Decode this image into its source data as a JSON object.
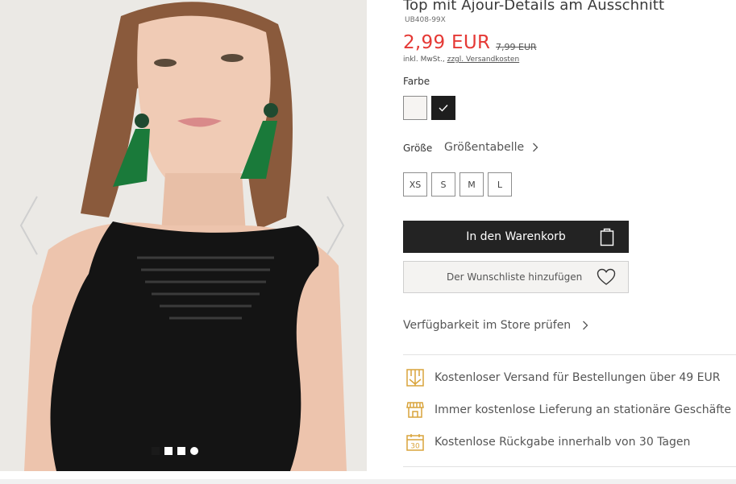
{
  "product": {
    "title": "Top mit Ajour-Details am Ausschnitt",
    "sku": "UB408-99X",
    "price": "2,99 EUR",
    "old_price": "7,99 EUR",
    "tax_prefix": "inkl. MwSt.,",
    "tax_link": "zzgl. Versandkosten"
  },
  "color": {
    "label": "Farbe",
    "swatches": [
      "white",
      "black"
    ],
    "selected": "black"
  },
  "size": {
    "label": "Größe",
    "table_link": "Größentabelle",
    "options": [
      "XS",
      "S",
      "M",
      "L"
    ]
  },
  "actions": {
    "cart_label": "In den Warenkorb",
    "wishlist_label": "Der Wunschliste hinzufügen",
    "store_check": "Verfügbarkeit im Store prüfen"
  },
  "benefits": [
    {
      "icon": "delivery-box-icon",
      "text": "Kostenloser Versand für Bestellungen über 49 EUR"
    },
    {
      "icon": "store-icon",
      "text": "Immer kostenlose Lieferung an stationäre Geschäfte"
    },
    {
      "icon": "calendar-30-icon",
      "text": "Kostenlose Rückgabe innerhalb von 30 Tagen"
    }
  ],
  "gallery": {
    "image_count": 4,
    "active_index": 3
  },
  "colors": {
    "accent_price": "#e53935",
    "button_dark": "#232323",
    "benefit_icon": "#d9a43b"
  }
}
